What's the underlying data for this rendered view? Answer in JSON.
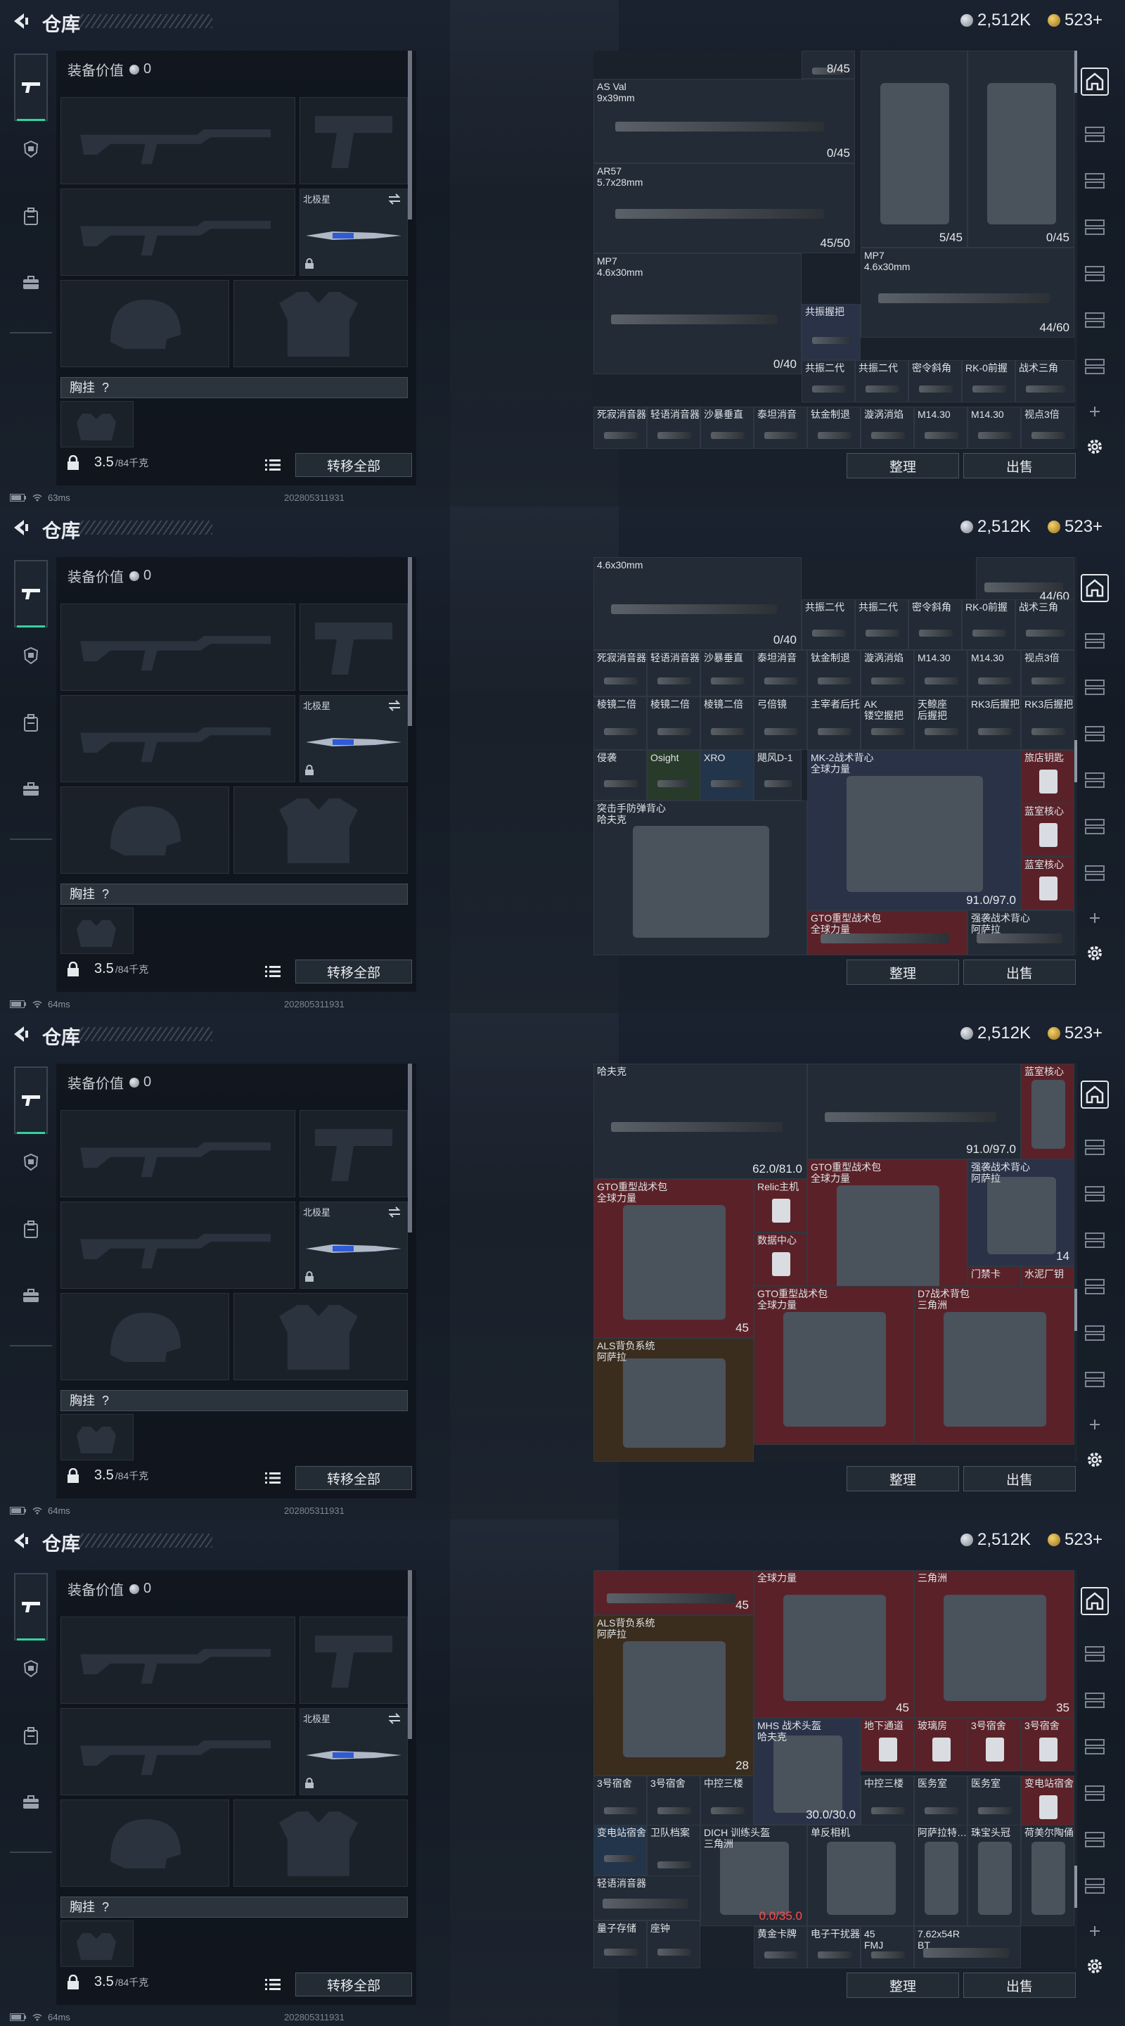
{
  "header": {
    "title": "仓库",
    "silver": "2,512K",
    "gold": "523+"
  },
  "loadout": {
    "value_label": "装备价值",
    "value": "0",
    "knife_name": "北极星",
    "chest_rig_label": "胸挂",
    "chest_rig_q": "?",
    "weight": "3.5",
    "weight_max": "/84千克",
    "transfer_label": "转移全部"
  },
  "status": {
    "latencies": [
      "63ms",
      "64ms",
      "64ms",
      "64ms"
    ],
    "build": "202805311931"
  },
  "buttons": {
    "sort": "整理",
    "sell": "出售"
  },
  "frames": [
    {
      "items": [
        {
          "name": "",
          "count": "8/45"
        },
        {
          "name": "AS Val\n9x39mm",
          "count": "0/45"
        },
        {
          "name": "",
          "count": "5/45"
        },
        {
          "name": "",
          "count": "0/45"
        },
        {
          "name": "AR57\n5.7x28mm",
          "count": "45/50"
        },
        {
          "name": "MP7\n4.6x30mm",
          "count": "44/60"
        },
        {
          "name": "MP7\n4.6x30mm",
          "count": "0/40"
        },
        {
          "name": "共振握把",
          "count": ""
        },
        {
          "name": "共振二代",
          "count": ""
        },
        {
          "name": "共振二代",
          "count": ""
        },
        {
          "name": "密令斜角",
          "count": ""
        },
        {
          "name": "RK-0前握",
          "count": ""
        },
        {
          "name": "战术三角",
          "count": ""
        },
        {
          "name": "死寂消音器",
          "count": ""
        },
        {
          "name": "轻语消音器",
          "count": ""
        },
        {
          "name": "沙暴垂直",
          "count": ""
        },
        {
          "name": "泰坦消音",
          "count": ""
        },
        {
          "name": "钛金制退",
          "count": ""
        },
        {
          "name": "漩涡消焰",
          "count": ""
        },
        {
          "name": "M14.30",
          "count": ""
        },
        {
          "name": "M14.30",
          "count": ""
        },
        {
          "name": "视点3倍",
          "count": ""
        }
      ]
    },
    {
      "items": [
        {
          "name": "4.6x30mm",
          "count": "0/40"
        },
        {
          "name": "",
          "count": "44/60"
        },
        {
          "name": "共振二代",
          "count": ""
        },
        {
          "name": "共振二代",
          "count": ""
        },
        {
          "name": "密令斜角",
          "count": ""
        },
        {
          "name": "RK-0前握",
          "count": ""
        },
        {
          "name": "战术三角",
          "count": ""
        },
        {
          "name": "死寂消音器",
          "count": ""
        },
        {
          "name": "轻语消音器",
          "count": ""
        },
        {
          "name": "沙暴垂直",
          "count": ""
        },
        {
          "name": "泰坦消音",
          "count": ""
        },
        {
          "name": "钛金制退",
          "count": ""
        },
        {
          "name": "漩涡消焰",
          "count": ""
        },
        {
          "name": "M14.30",
          "count": ""
        },
        {
          "name": "M14.30",
          "count": ""
        },
        {
          "name": "视点3倍",
          "count": ""
        },
        {
          "name": "棱镜二倍",
          "count": ""
        },
        {
          "name": "棱镜二倍",
          "count": ""
        },
        {
          "name": "棱镜二倍",
          "count": ""
        },
        {
          "name": "弓倍镜",
          "count": ""
        },
        {
          "name": "主宰者后托",
          "count": ""
        },
        {
          "name": "AK\n镂空握把",
          "count": ""
        },
        {
          "name": "天鲸座\n后握把",
          "count": ""
        },
        {
          "name": "RK3后握把",
          "count": ""
        },
        {
          "name": "RK3后握把",
          "count": ""
        },
        {
          "name": "侵袭",
          "count": ""
        },
        {
          "name": "Osight",
          "count": ""
        },
        {
          "name": "XRO",
          "count": ""
        },
        {
          "name": "飓风D-1",
          "count": ""
        },
        {
          "name": "MK-2战术背心\n全球力量",
          "count": "91.0/97.0"
        },
        {
          "name": "旅店钥匙",
          "count": ""
        },
        {
          "name": "突击手防弹背心\n哈夫克",
          "count": ""
        },
        {
          "name": "蓝室核心",
          "count": ""
        },
        {
          "name": "蓝室核心",
          "count": ""
        },
        {
          "name": "GTO重型战术包\n全球力量",
          "count": ""
        },
        {
          "name": "强袭战术背心\n阿萨拉",
          "count": ""
        }
      ]
    },
    {
      "items": [
        {
          "name": "哈夫克",
          "count": "62.0/81.0"
        },
        {
          "name": "",
          "count": "91.0/97.0"
        },
        {
          "name": "蓝室核心",
          "count": ""
        },
        {
          "name": "GTO重型战术包\n全球力量",
          "count": "45"
        },
        {
          "name": "强袭战术背心\n阿萨拉",
          "count": "14"
        },
        {
          "name": "GTO重型战术包\n全球力量",
          "count": "45"
        },
        {
          "name": "Relic主机",
          "count": ""
        },
        {
          "name": "数据中心",
          "count": ""
        },
        {
          "name": "门禁卡",
          "count": ""
        },
        {
          "name": "水泥厂钥",
          "count": ""
        },
        {
          "name": "GTO重型战术包\n全球力量",
          "count": ""
        },
        {
          "name": "D7战术背包\n三角洲",
          "count": ""
        },
        {
          "name": "ALS背负系统\n阿萨拉",
          "count": ""
        }
      ]
    },
    {
      "items": [
        {
          "name": "",
          "count": "45"
        },
        {
          "name": "全球力量",
          "count": "45"
        },
        {
          "name": "三角洲",
          "count": "35"
        },
        {
          "name": "ALS背负系统\n阿萨拉",
          "count": "28"
        },
        {
          "name": "MHS 战术头盔\n哈夫克",
          "count": "30.0/30.0"
        },
        {
          "name": "地下通道",
          "count": ""
        },
        {
          "name": "玻璃房",
          "count": ""
        },
        {
          "name": "3号宿舍",
          "count": ""
        },
        {
          "name": "3号宿舍",
          "count": ""
        },
        {
          "name": "3号宿舍",
          "count": ""
        },
        {
          "name": "3号宿舍",
          "count": ""
        },
        {
          "name": "中控三楼",
          "count": ""
        },
        {
          "name": "中控三楼",
          "count": ""
        },
        {
          "name": "医务室",
          "count": ""
        },
        {
          "name": "医务室",
          "count": ""
        },
        {
          "name": "变电站宿舍",
          "count": ""
        },
        {
          "name": "变电站宿舍",
          "count": ""
        },
        {
          "name": "卫队档案",
          "count": ""
        },
        {
          "name": "DICH 训练头盔\n三角洲",
          "count": "0.0/35.0"
        },
        {
          "name": "单反相机",
          "count": ""
        },
        {
          "name": "阿萨拉特…",
          "count": ""
        },
        {
          "name": "珠宝头冠",
          "count": ""
        },
        {
          "name": "荷美尔陶俑",
          "count": ""
        },
        {
          "name": "轻语消音器",
          "count": ""
        },
        {
          "name": "量子存储",
          "count": ""
        },
        {
          "name": "座钟",
          "count": ""
        },
        {
          "name": "黄金卡牌",
          "count": ""
        },
        {
          "name": "电子干扰器",
          "count": ""
        },
        {
          "name": "45\nFMJ",
          "count": ""
        },
        {
          "name": "7.62x54R\nBT",
          "count": ""
        }
      ]
    }
  ]
}
